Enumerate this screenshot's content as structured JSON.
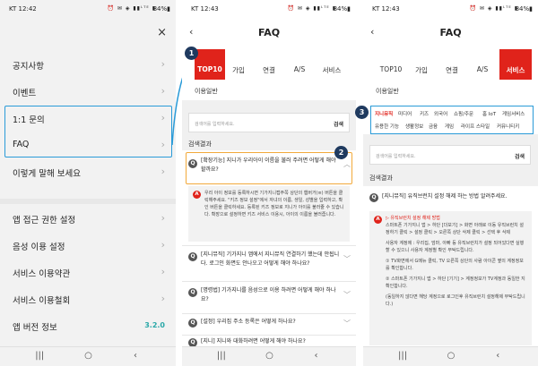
{
  "status": {
    "carrier_p1": "KT 12:42",
    "carrier_p2": "KT 12:43",
    "carrier_p3": "KT 12:43",
    "signal": "⏰ ✉ ◈ ▮▮ᴸᵀᴱ ▮",
    "battery": "84%▮"
  },
  "menu": {
    "close": "×",
    "items": [
      {
        "label": "공지사항"
      },
      {
        "label": "이벤트"
      },
      {
        "label": "1:1 문의"
      },
      {
        "label": "FAQ"
      },
      {
        "label": "이렇게 말해 보세요"
      },
      {
        "label": "앱 접근 권한 설정"
      },
      {
        "label": "음성 이용 설정"
      },
      {
        "label": "서비스 이용약관"
      },
      {
        "label": "서비스 이용철회"
      },
      {
        "label": "앱 버전 정보",
        "value": "3.2.0"
      }
    ],
    "chevron": "›"
  },
  "faq": {
    "title": "FAQ",
    "back": "‹",
    "tabs": [
      "TOP10",
      "가입",
      "연결",
      "A/S",
      "서비스"
    ],
    "subtab": "이용일반",
    "search_placeholder": "검색어를 입력하세요.",
    "search_button": "검색",
    "results_title": "검색결과",
    "q_badge": "Q",
    "a_badge": "A",
    "questions": [
      "[확장기능] 지니가 우리아이 이름을 불러 주려면 어떻게 해야 할까요?",
      "[지니뮤직] 기가지니 앱에서 지니뮤직 연결하기 했는데 안됩니다. 로그인 화면도 안나오고 어떻게 해야 하나요?",
      "[명령법] 기가지니를 음성으로 이용 하려면 어떻게 해야 하나요?",
      "[설정] 우리집 주소 등록은 어떻게 하나요?",
      "[지니] 지니와 대화하려면 어떻게 해야 하나요?"
    ],
    "answer1": "우리 아이 정보를 등록하시면 기가지니캡주쪽 상단의 햄버거(≡) 버튼을 클릭해주세요. \"키즈 정보 설정\"에서 자녀의 이름, 생일, 성별을 입력하고, 확인 버튼을 클릭하세요. 등록된 키즈 정보로 지니가 아이를 불러줄 수 있습니다. 확장으로 설정하면 키즈 서비스 이용시, 아이의 이름을 불러줍니다.",
    "p3_question": "[지니뮤직] 유직브런치 설정 해제 하는 방법 알려주세요.",
    "answer3": [
      "▷ 유직브런치 설정 해제 방법",
      "스마트폰 기가지니 앱 > 하단 [더보기] > 화면 아래로 이동 유직브런치 설정하기 클릭 > 설정 클릭 > 오른쪽 상단 삭제 클릭 > 선택 후 삭제",
      "사용자 계정에 : 우리집, 엄마, 아빠 등 유직브런치가 설정 되어있다면 실행할 수 있으니 사용자 계정별 확인 부탁드립니다.",
      "① TV화면에서 G메뉴 클릭, TV 오른쪽 상단의 사람 아이콘 옆의 계정정보를 확인합니다.",
      "② 스마트폰 기가지니 앱 > 하단 [기기] > 계정정보가 TV계정과 동일한 지 확인합니다.",
      "(동일하지 않다면 해당 계정으로 로그인후 유직브런치 설정해제 부탁드립니다.)"
    ],
    "categories": [
      "지니뮤직",
      "미디어",
      "키즈",
      "외국어",
      "쇼핑/주문",
      "홈 IoT",
      "게임서비스",
      "유용한 기능",
      "생활정보",
      "금융",
      "게임",
      "라이프 스타일",
      "커뮤니티키"
    ]
  },
  "steps": [
    "1",
    "2",
    "3"
  ],
  "nav": {
    "recent": "|||",
    "home": "○",
    "back": "‹"
  }
}
